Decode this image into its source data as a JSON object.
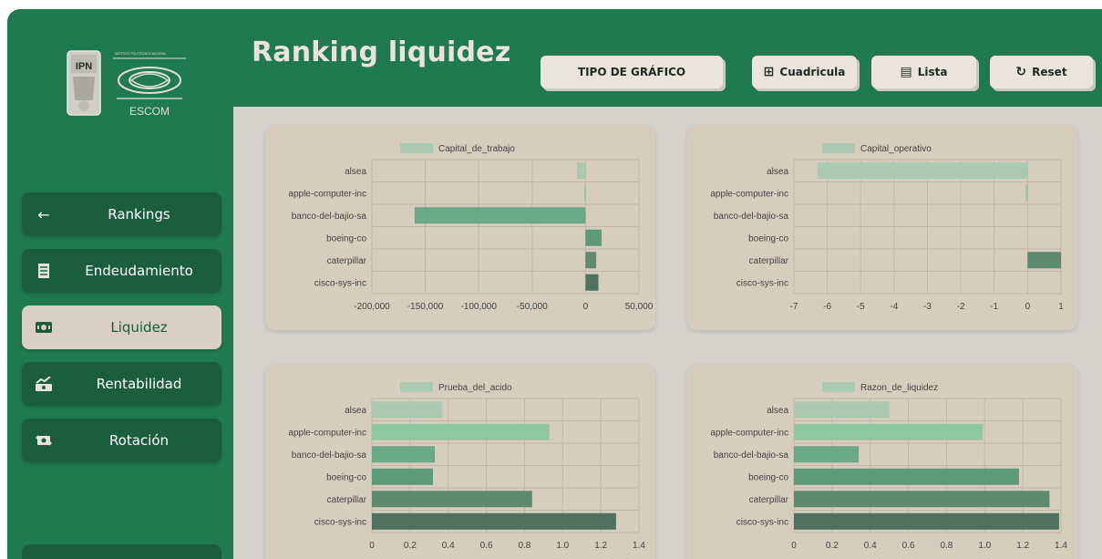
{
  "header": {
    "title": "Ranking liquidez",
    "chart_type_button": "TIPO DE GRÁFICO",
    "grid_button": "Cuadricula",
    "list_button": "Lista",
    "reset_button": "Reset"
  },
  "logo": {
    "text": "ESCOM",
    "shield_text": "IPN",
    "small_text": "INSTITUTO POLITÉCNICO NACIONAL"
  },
  "sidebar": {
    "items": [
      {
        "label": "Rankings",
        "icon": "arrow-left-icon"
      },
      {
        "label": "Endeudamiento",
        "icon": "receipt-icon"
      },
      {
        "label": "Liquidez",
        "icon": "cash-icon",
        "active": true
      },
      {
        "label": "Rentabilidad",
        "icon": "growth-icon"
      },
      {
        "label": "Rotación",
        "icon": "exchange-icon"
      }
    ]
  },
  "colors": {
    "primary_green": "#1f7a4d",
    "dark_green": "#1a5e3b",
    "card_bg": "#d6cdbd",
    "active_bg": "#d9cfc2",
    "bar_colors": [
      "#a9c9b0",
      "#8fc7a3",
      "#6aa986",
      "#5d9a78",
      "#5e8a6e",
      "#4f725e"
    ]
  },
  "chart_data": [
    {
      "type": "bar",
      "orientation": "horizontal",
      "legend": "Capital_de_trabajo",
      "categories": [
        "alsea",
        "apple-computer-inc",
        "banco-del-bajio-sa",
        "boeing-co",
        "caterpillar",
        "cisco-sys-inc"
      ],
      "values": [
        -8000,
        -1000,
        -160000,
        15000,
        10000,
        12000
      ],
      "xlim": [
        -200000,
        50000
      ],
      "xticks": [
        -200000,
        -150000,
        -100000,
        -50000,
        0,
        50000
      ],
      "xtick_labels": [
        "-200,000",
        "-150,000",
        "-100,000",
        "-50,000",
        "0",
        "50,000"
      ]
    },
    {
      "type": "bar",
      "orientation": "horizontal",
      "legend": "Capital_operativo",
      "categories": [
        "alsea",
        "apple-computer-inc",
        "banco-del-bajio-sa",
        "boeing-co",
        "caterpillar",
        "cisco-sys-inc"
      ],
      "values": [
        -6.3,
        -0.05,
        0,
        0,
        1,
        0
      ],
      "xlim": [
        -7,
        1
      ],
      "xticks": [
        -7,
        -6,
        -5,
        -4,
        -3,
        -2,
        -1,
        0,
        1
      ],
      "xtick_labels": [
        "-7",
        "-6",
        "-5",
        "-4",
        "-3",
        "-2",
        "-1",
        "0",
        "1"
      ]
    },
    {
      "type": "bar",
      "orientation": "horizontal",
      "legend": "Prueba_del_acido",
      "categories": [
        "alsea",
        "apple-computer-inc",
        "banco-del-bajio-sa",
        "boeing-co",
        "caterpillar",
        "cisco-sys-inc"
      ],
      "values": [
        0.37,
        0.93,
        0.33,
        0.32,
        0.84,
        1.28
      ],
      "xlim": [
        0,
        1.4
      ],
      "xticks": [
        0,
        0.2,
        0.4,
        0.6,
        0.8,
        1.0,
        1.2,
        1.4
      ],
      "xtick_labels": [
        "0",
        "0.2",
        "0.4",
        "0.6",
        "0.8",
        "1.0",
        "1.2",
        "1.4"
      ]
    },
    {
      "type": "bar",
      "orientation": "horizontal",
      "legend": "Razon_de_liquidez",
      "categories": [
        "alsea",
        "apple-computer-inc",
        "banco-del-bajio-sa",
        "boeing-co",
        "caterpillar",
        "cisco-sys-inc"
      ],
      "values": [
        0.5,
        0.99,
        0.34,
        1.18,
        1.34,
        1.39
      ],
      "xlim": [
        0,
        1.4
      ],
      "xticks": [
        0,
        0.2,
        0.4,
        0.6,
        0.8,
        1.0,
        1.2,
        1.4
      ],
      "xtick_labels": [
        "0",
        "0.2",
        "0.4",
        "0.6",
        "0.8",
        "1.0",
        "1.2",
        "1.4"
      ]
    }
  ]
}
